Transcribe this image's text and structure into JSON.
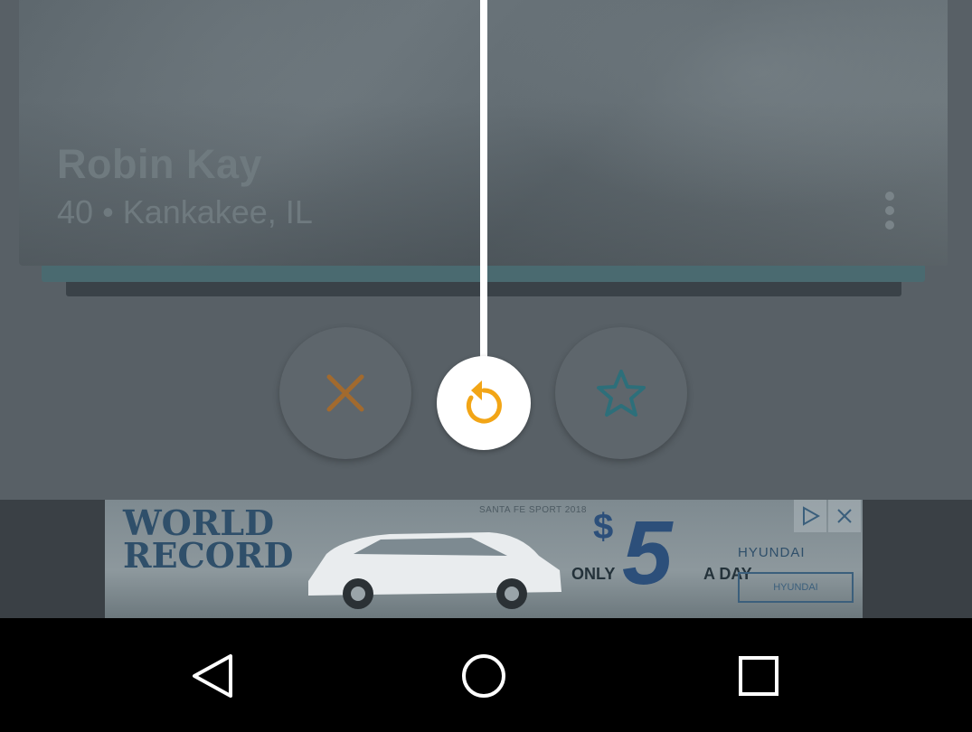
{
  "profile": {
    "name": "Robin Kay",
    "age": "40",
    "separator": "•",
    "location": "Kankakee, IL"
  },
  "actions": {
    "nope_icon": "close-icon",
    "undo_icon": "undo-icon",
    "favorite_icon": "star-icon"
  },
  "colors": {
    "nope": "#a26a2e",
    "undo": "#f2a516",
    "favorite": "#2d6f7a"
  },
  "ad": {
    "headline_line1": "WORLD",
    "headline_line2": "RECORD",
    "small_text": "SANTA FE SPORT 2018",
    "dollar": "$",
    "price": "5",
    "only": "ONLY",
    "a_day": "A DAY",
    "brand": "HYUNDAI",
    "dealer": "HYUNDAI"
  },
  "navbar": {
    "back": "back-icon",
    "home": "home-icon",
    "recents": "recents-icon"
  }
}
